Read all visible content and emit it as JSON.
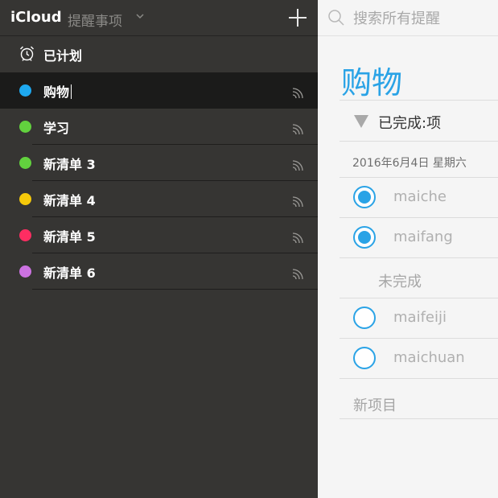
{
  "header": {
    "app_title": "iCloud",
    "app_subtitle": "提醒事项",
    "add_icon": "plus-icon",
    "chevron_icon": "chevron-down-icon"
  },
  "sidebar": {
    "scheduled": {
      "label": "已计划",
      "icon": "alarm-clock-icon"
    },
    "lists": [
      {
        "label": "购物",
        "color": "#1ea9f0",
        "selected": true,
        "editing": true,
        "share_icon": "shared-icon"
      },
      {
        "label": "学习",
        "color": "#62d13e",
        "share_icon": "shared-icon"
      },
      {
        "label": "新清单 3",
        "color": "#62d13e",
        "share_icon": "shared-icon"
      },
      {
        "label": "新清单 4",
        "color": "#f5c90a",
        "share_icon": "shared-icon"
      },
      {
        "label": "新清单 5",
        "color": "#ff2d62",
        "share_icon": "shared-icon"
      },
      {
        "label": "新清单 6",
        "color": "#cc72e1",
        "share_icon": "shared-icon"
      }
    ]
  },
  "search": {
    "placeholder": "搜索所有提醒",
    "icon": "search-icon"
  },
  "main": {
    "title": "购物",
    "completed_label": "已完成:项",
    "completed_toggle_icon": "triangle-down-icon",
    "date_label": "2016年6月4日 星期六",
    "completed_items": [
      {
        "text": "maiche",
        "done": true
      },
      {
        "text": "maifang",
        "done": true
      }
    ],
    "incomplete_label": "未完成",
    "incomplete_items": [
      {
        "text": "maifeiji",
        "done": false
      },
      {
        "text": "maichuan",
        "done": false
      }
    ],
    "new_item_label": "新项目",
    "accent_color": "#2aa3e6"
  }
}
